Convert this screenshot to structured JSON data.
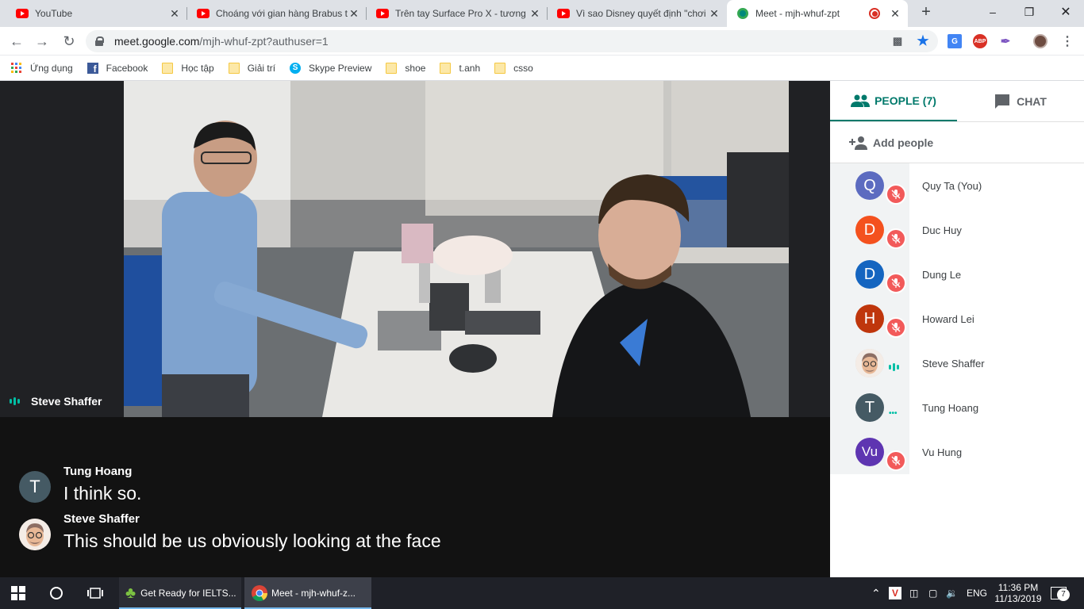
{
  "browser": {
    "tabs": [
      {
        "title": "YouTube",
        "icon": "youtube-icon"
      },
      {
        "title": "Choáng với gian hàng Brabus t",
        "icon": "youtube-icon"
      },
      {
        "title": "Trên tay Surface Pro X - tương",
        "icon": "youtube-icon"
      },
      {
        "title": "Vì sao Disney quyết định \"chơi",
        "icon": "youtube-icon"
      },
      {
        "title": "Meet - mjh-whuf-zpt",
        "icon": "google-meet-icon",
        "active": true,
        "recording": true
      }
    ],
    "new_tab": "+",
    "url_host": "meet.google.com",
    "url_path": "/mjh-whuf-zpt?authuser=1",
    "extensions": [
      "camera-icon",
      "star-icon",
      "translate-icon",
      "adblock-icon",
      "pen-icon",
      "profile-avatar"
    ],
    "adblock_label": "ABP"
  },
  "bookmarks": [
    {
      "label": "Ứng dụng",
      "icon": "apps-grid-icon"
    },
    {
      "label": "Facebook",
      "icon": "facebook-icon"
    },
    {
      "label": "Học tập",
      "icon": "folder-icon"
    },
    {
      "label": "Giải trí",
      "icon": "folder-icon"
    },
    {
      "label": "Skype Preview",
      "icon": "skype-icon"
    },
    {
      "label": "shoe",
      "icon": "folder-icon"
    },
    {
      "label": "t.anh",
      "icon": "folder-icon"
    },
    {
      "label": "csso",
      "icon": "folder-icon"
    }
  ],
  "meet": {
    "active_speaker": "Steve Shaffer",
    "captions": [
      {
        "initial": "T",
        "name": "Tung Hoang",
        "text": "I think so."
      },
      {
        "initial": "",
        "name": "Steve Shaffer",
        "text": "This should be us obviously looking at the face"
      }
    ]
  },
  "panel": {
    "people_tab": "PEOPLE (7)",
    "chat_tab": "CHAT",
    "add_people": "Add people",
    "people": [
      {
        "initial": "Q",
        "name": "Quy Ta (You)",
        "color": "#5c6bc0",
        "status": "muted"
      },
      {
        "initial": "D",
        "name": "Duc Huy",
        "color": "#f4511e",
        "status": "muted"
      },
      {
        "initial": "D",
        "name": "Dung Le",
        "color": "#1565c0",
        "status": "muted"
      },
      {
        "initial": "H",
        "name": "Howard Lei",
        "color": "#bf360c",
        "status": "muted"
      },
      {
        "initial": "",
        "name": "Steve Shaffer",
        "color": "#d7ccc8",
        "status": "speaking"
      },
      {
        "initial": "T",
        "name": "Tung Hoang",
        "color": "#455a64",
        "status": "active"
      },
      {
        "initial": "Vu",
        "name": "Vu Hung",
        "color": "#5e35b1",
        "status": "muted"
      }
    ]
  },
  "taskbar": {
    "tasks": [
      {
        "label": "Get Ready for IELTS...",
        "icon": "clover-app-icon"
      },
      {
        "label": "Meet - mjh-whuf-z...",
        "icon": "chrome-icon"
      }
    ],
    "language": "ENG",
    "time": "11:36 PM",
    "date": "11/13/2019",
    "notifications": "7"
  },
  "colors": {
    "accent": "#00796b",
    "mute_red": "#f25a5a",
    "speaking_teal": "#00bfa5"
  }
}
